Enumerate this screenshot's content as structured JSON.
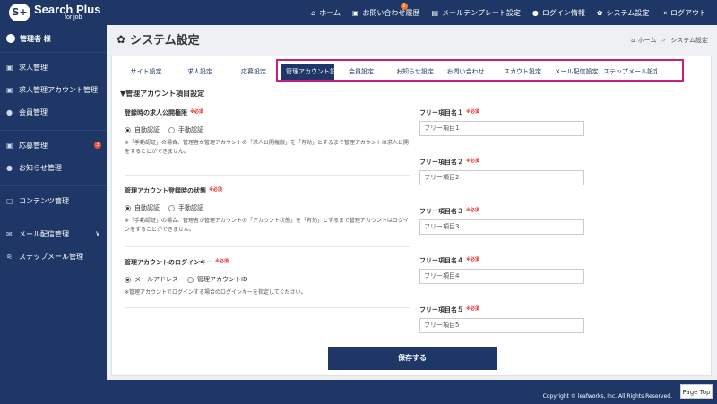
{
  "brand": {
    "name": "Search Plus",
    "sub": "for job",
    "mark": "S+"
  },
  "topnav": [
    {
      "icon": "home-icon",
      "glyph": "⌂",
      "label": "ホーム"
    },
    {
      "icon": "inbox-icon",
      "glyph": "▣",
      "label": "お問い合わせ履歴",
      "badge": "1"
    },
    {
      "icon": "document-icon",
      "glyph": "▤",
      "label": "メールテンプレート設定"
    },
    {
      "icon": "user-icon",
      "glyph": "●",
      "label": "ログイン情報"
    },
    {
      "icon": "gear-icon",
      "glyph": "✿",
      "label": "システム設定"
    },
    {
      "icon": "logout-icon",
      "glyph": "⇥",
      "label": "ログアウト"
    }
  ],
  "sidebar": {
    "user": "管理者 様",
    "items": [
      {
        "icon": "job-icon",
        "glyph": "▣",
        "label": "求人管理"
      },
      {
        "icon": "account-icon",
        "glyph": "▣",
        "label": "求人管理アカウント管理"
      },
      {
        "icon": "member-icon",
        "glyph": "●",
        "label": "会員管理"
      },
      {
        "icon": "application-icon",
        "glyph": "▣",
        "label": "応募管理",
        "badge": "3"
      },
      {
        "icon": "info-icon",
        "glyph": "●",
        "label": "お知らせ管理"
      },
      {
        "icon": "content-icon",
        "glyph": "▢",
        "label": "コンテンツ管理"
      },
      {
        "icon": "mail-icon",
        "glyph": "✉",
        "label": "メール配信管理",
        "chevron": "∨"
      },
      {
        "icon": "step-icon",
        "glyph": "⚟",
        "label": "ステップメール管理"
      }
    ]
  },
  "page": {
    "title": "システム設定",
    "breadcrumb": {
      "home": "ホーム",
      "current": "システム設定"
    }
  },
  "tabs": [
    "サイト設定",
    "求人設定",
    "応募設定",
    "管理アカウント設定",
    "会員設定",
    "お知らせ設定",
    "お問い合わせ…",
    "スカウト設定",
    "メール配信設定",
    "ステップメール設定"
  ],
  "active_tab": "管理アカウント設定",
  "section_title": "▼管理アカウント項目設定",
  "required_label": "※必須",
  "fields": {
    "publish": {
      "label": "登録時の求人公開権限",
      "options": [
        "自動認証",
        "手動認証"
      ],
      "selected": "自動認証",
      "note": "※「手動認証」の場合、管理者が管理アカウントの「求人公開権限」を「有効」とするまで管理アカウントは求人公開をすることができません。"
    },
    "status": {
      "label": "管理アカウント登録時の状態",
      "options": [
        "自動認証",
        "手動認証"
      ],
      "selected": "自動認証",
      "note": "※「手動認証」の場合、管理者が管理アカウントの「アカウント状態」を「有効」とするまで管理アカウントはログインをすることができません。"
    },
    "login_key": {
      "label": "管理アカウントのログインキー",
      "options": [
        "メールアドレス",
        "管理アカウントID"
      ],
      "selected": "メールアドレス",
      "note": "※管理アカウントでログインする場合のログインキーを指定してください。"
    }
  },
  "free_fields": [
    {
      "label": "フリー項目名１",
      "placeholder": "フリー項目1"
    },
    {
      "label": "フリー項目名２",
      "placeholder": "フリー項目2"
    },
    {
      "label": "フリー項目名３",
      "placeholder": "フリー項目3"
    },
    {
      "label": "フリー項目名４",
      "placeholder": "フリー項目4"
    },
    {
      "label": "フリー項目名５",
      "placeholder": "フリー項目5"
    }
  ],
  "save_label": "保存する",
  "footer": {
    "copyright": "Copyright © leafworks, Inc. All Rights Reserved.",
    "page_top": "Page Top"
  },
  "colors": {
    "navy": "#1e3766",
    "highlight": "#c71f7f",
    "required": "#e1241f",
    "badge": "#f47a20"
  }
}
